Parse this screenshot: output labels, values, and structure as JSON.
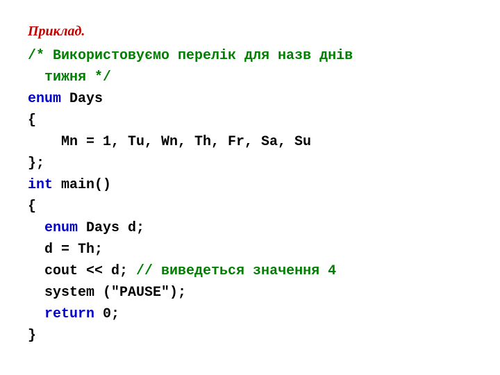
{
  "title": "Приклад.",
  "lines": {
    "comment": "/* Використовуємо перелік для назв днів тижня */",
    "enum_kw": "enum",
    "enum_name": " Days",
    "brace_open": "{",
    "enum_values": "Mn = 1, Tu, Wn, Th, Fr, Sa, Su",
    "brace_close_semi": "};",
    "int_kw": "int",
    "main_sig": " main()",
    "brace_open2": "{",
    "enum_kw2": "enum",
    "decl": " Days d;",
    "assign": "d = Th;",
    "cout_part": "cout << d; ",
    "inline_comment": "// виведеться значення 4",
    "system": "system (\"PAUSE\");",
    "return_kw": "return",
    "return_val": " 0;",
    "brace_close2": "}"
  }
}
